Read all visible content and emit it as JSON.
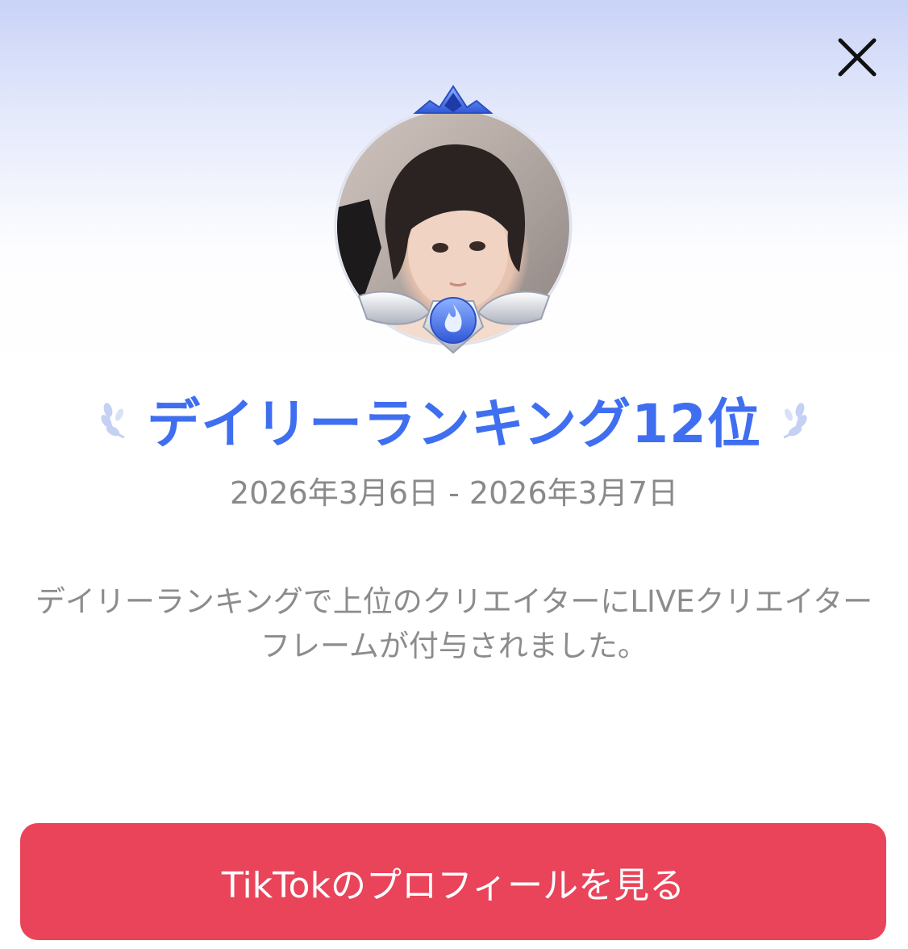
{
  "header": {
    "close_icon": "close-icon"
  },
  "avatar": {
    "frame_icon": "creator-frame-icon",
    "badge_icon": "flame-badge-icon"
  },
  "ranking": {
    "title": "デイリーランキング12位",
    "date_range": "2026年3月6日 - 2026年3月7日",
    "laurel_icon": "laurel-icon"
  },
  "description": {
    "text": "デイリーランキングで上位のクリエイターにLIVEクリエイターフレームが付与されました。"
  },
  "cta": {
    "label": "TikTokのプロフィールを見る"
  },
  "colors": {
    "accent_blue": "#3f6ff0",
    "button_red": "#e9445a",
    "muted_text": "#8a8a8a"
  }
}
